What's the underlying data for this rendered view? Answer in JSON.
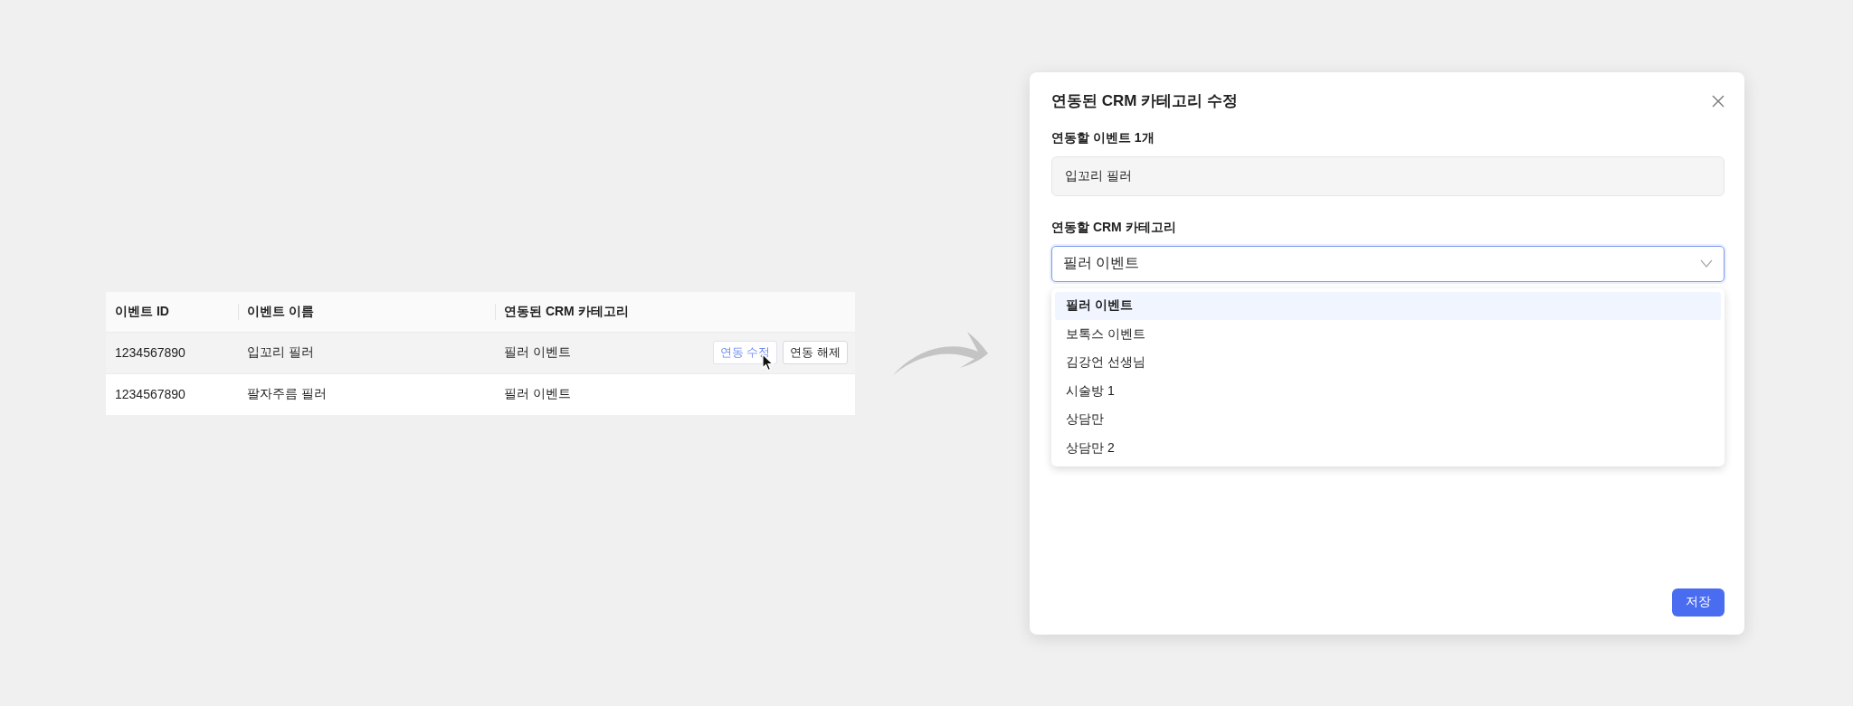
{
  "table": {
    "columns": [
      "이벤트 ID",
      "이벤트 이름",
      "연동된 CRM 카테고리"
    ],
    "rows": [
      {
        "cells": [
          "1234567890",
          "입꼬리 필러",
          "필러 이벤트"
        ],
        "hovered": true,
        "actions": [
          {
            "label": "연동 수정",
            "active": true
          },
          {
            "label": "연동 해제",
            "active": false
          }
        ]
      },
      {
        "cells": [
          "1234567890",
          "팔자주름 필러",
          "필러 이벤트"
        ],
        "hovered": false,
        "actions": []
      }
    ]
  },
  "modal": {
    "title": "연동된 CRM 카테고리 수정",
    "event_label": "연동할 이벤트 1개",
    "event_value": "입꼬리 필러",
    "category_label": "연동할 CRM 카테고리",
    "category_value": "필러 이벤트",
    "dropdown_open": true,
    "options": [
      {
        "label": "필러 이벤트",
        "selected": true
      },
      {
        "label": "보톡스 이벤트",
        "selected": false
      },
      {
        "label": "김강언 선생님",
        "selected": false
      },
      {
        "label": "시술방 1",
        "selected": false
      },
      {
        "label": "상담만",
        "selected": false
      },
      {
        "label": "상담만 2",
        "selected": false
      }
    ],
    "save_button": "저장"
  }
}
